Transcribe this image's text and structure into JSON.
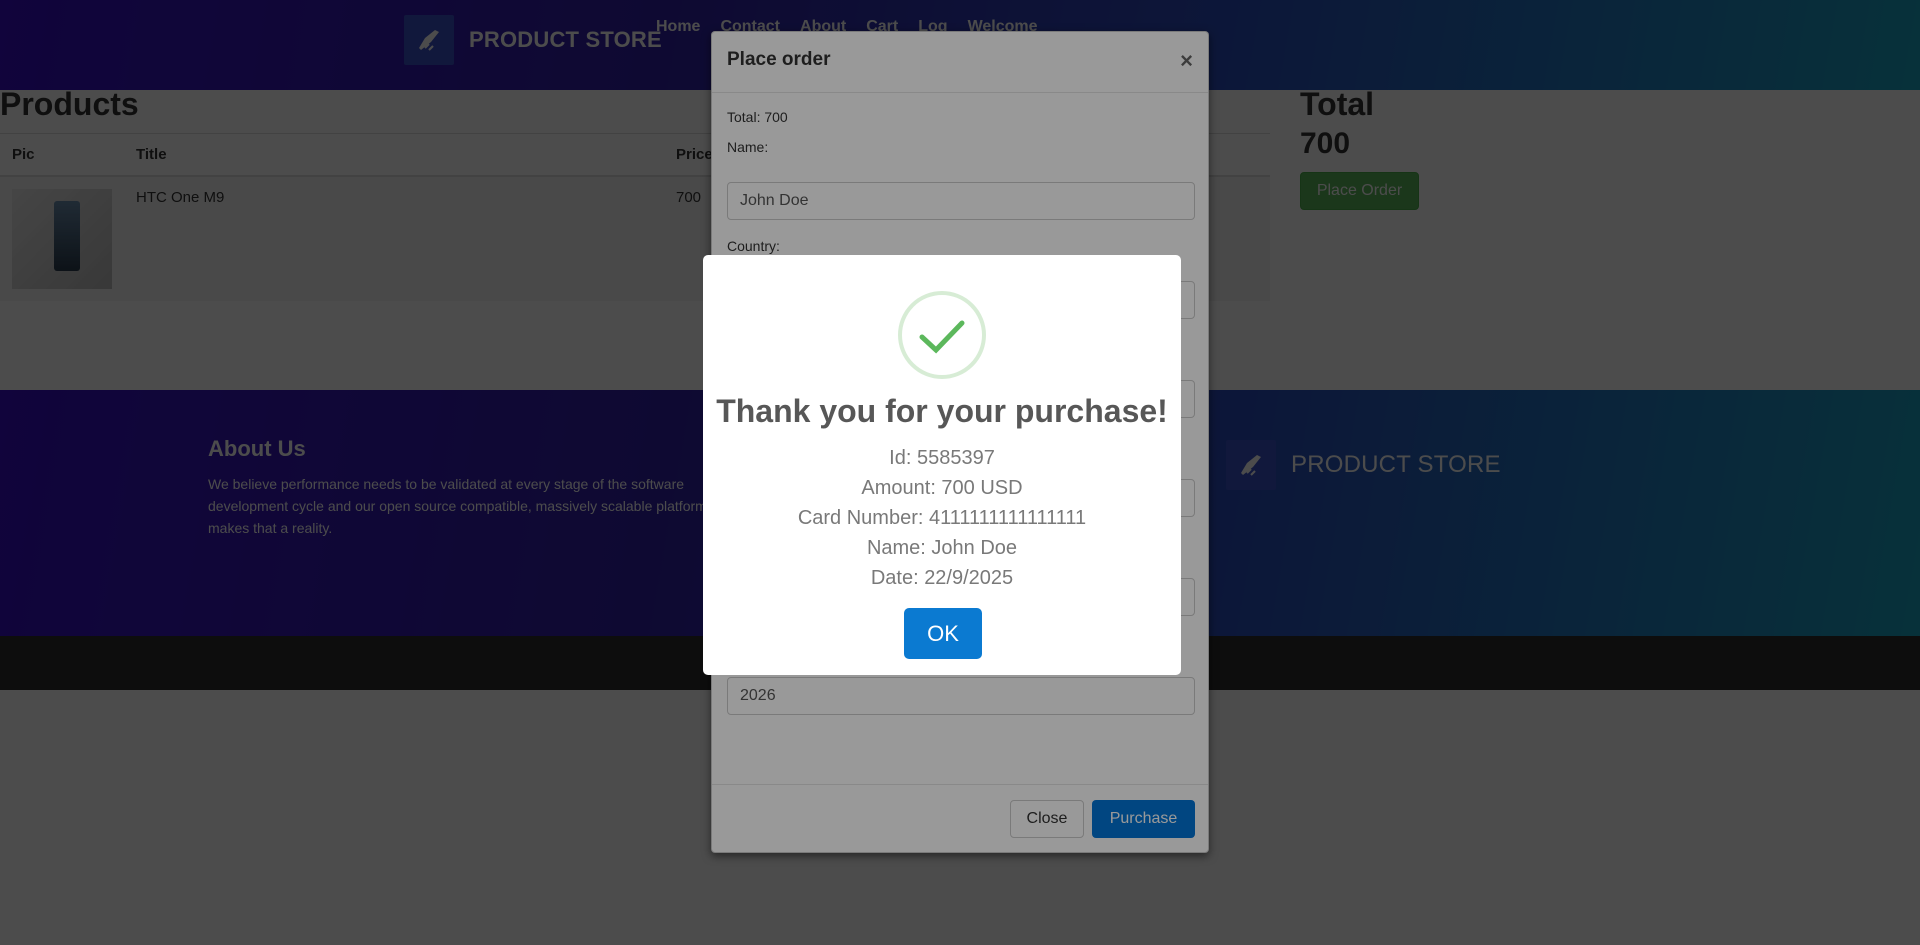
{
  "navbar": {
    "brand": "PRODUCT STORE",
    "links": [
      "Home",
      "Contact",
      "About",
      "Cart",
      "Log",
      "Welcome"
    ]
  },
  "products": {
    "heading": "Products",
    "columns": [
      "Pic",
      "Title",
      "Price"
    ],
    "rows": [
      {
        "title": "HTC One M9",
        "price": "700"
      }
    ]
  },
  "total": {
    "heading": "Total",
    "value": "700",
    "place_order_label": "Place Order"
  },
  "footer": {
    "about_title": "About Us",
    "about_text": "We believe performance needs to be validated at every stage of the software development cycle and our open source compatible, massively scalable platform makes that a reality.",
    "brand": "PRODUCT STORE"
  },
  "modal": {
    "title": "Place order",
    "close_x": "×",
    "total_label": "Total: 700",
    "name_label": "Name:",
    "name_value": "John Doe",
    "country_label": "Country:",
    "year_value": "2026",
    "close_label": "Close",
    "purchase_label": "Purchase"
  },
  "alert": {
    "title": "Thank you for your purchase!",
    "id_line": "Id: 5585397",
    "amount_line": "Amount: 700 USD",
    "card_line": "Card Number: 4111111111111111",
    "name_line": "Name: John Doe",
    "date_line": "Date: 22/9/2025",
    "ok_label": "OK"
  },
  "colors": {
    "primary_blue": "#0275d8",
    "success_green": "#5cb85c",
    "check_green": "#5cb85c"
  }
}
